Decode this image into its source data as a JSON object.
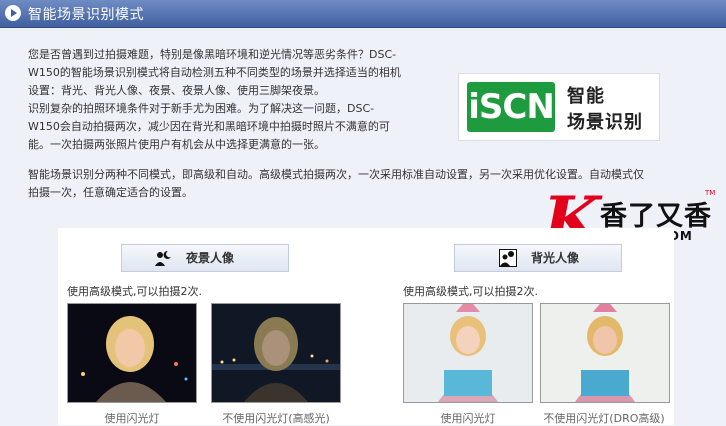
{
  "header": {
    "title": "智能场景识别模式"
  },
  "intro": {
    "lines": [
      "您是否曾遇到过拍摄难题，特别是像黑暗环境和逆光情况等恶劣条件？DSC-",
      "W150的智能场景识别模式将自动检测五种不同类型的场景并选择适当的相机",
      "设置：背光、背光人像、夜景、夜景人像、使用三脚架夜景。",
      "识别复杂的拍照环境条件对于新手尤为困难。为了解决这一问题，DSC-",
      "W150会自动拍摄两次，减少因在背光和黑暗环境中拍摄时照片不满意的可",
      "能。一次拍摄两张照片使用户有机会从中选择更满意的一张。"
    ],
    "wide_lines": [
      "智能场景识别分两种不同模式，即高级和自动。高级模式拍摄两次，一次采用标准自动设置，另一次采用优化设置。自动模式仅",
      "拍摄一次，任意确定适合的设置。"
    ]
  },
  "logo": {
    "mark": "iSCN",
    "line1": "智能",
    "line2": "场景识别"
  },
  "watermark": {
    "letter": "K",
    "brand": "香了又香",
    "url": "KLYKK.COM",
    "tm": "TM"
  },
  "modes": [
    {
      "label": "夜景人像",
      "icon": "night-portrait-icon",
      "caption": "使用高级模式,可以拍摄2次.",
      "photos": [
        {
          "label": "使用闪光灯"
        },
        {
          "label": "不使用闪光灯(高感光)"
        }
      ]
    },
    {
      "label": "背光人像",
      "icon": "backlight-portrait-icon",
      "caption": "使用高级模式,可以拍摄2次.",
      "photos": [
        {
          "label": "使用闪光灯"
        },
        {
          "label": "不使用闪光灯(DRO高级)"
        }
      ]
    }
  ]
}
